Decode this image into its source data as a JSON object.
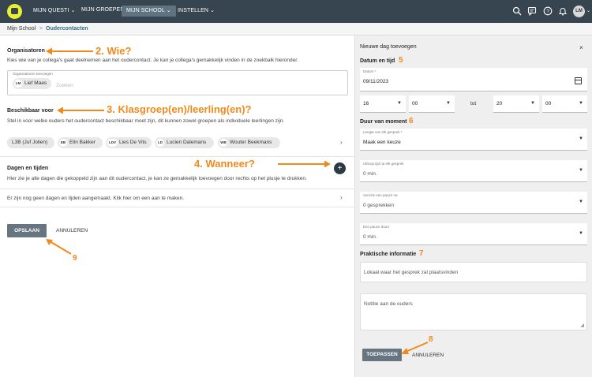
{
  "nav": {
    "items": [
      "MIJN QUESTI",
      "MIJN GROEPEN",
      "MIJN SCHOOL",
      "INSTELLEN"
    ],
    "avatar": "LM"
  },
  "breadcrumb": {
    "home": "Mijn School",
    "separator": ">",
    "current": "Oudercontacten"
  },
  "organisatoren": {
    "title": "Organisatoren",
    "desc": "Kies wie van je collega's gaat deelnemen aan het oudercontact. Je kan je collega's gemakkelijk vinden in de zoekbalk hieronder.",
    "field_label": "Organisatoren toevoegen",
    "chip_initials": "LM",
    "chip_name": "Lief Maes",
    "search_placeholder": "Zoeken"
  },
  "beschikbaar": {
    "title": "Beschikbaar voor",
    "desc": "Stel in voor welke ouders het oudercontact beschikbaar moet zijn, dit kunnen zowel groepen als individuele leerlingen zijn.",
    "chips": [
      {
        "initials": "",
        "name": "L3B (Juf Jolien)"
      },
      {
        "initials": "EB",
        "name": "Elin Bakker"
      },
      {
        "initials": "LDV",
        "name": "Lies De Vits"
      },
      {
        "initials": "LD",
        "name": "Lucien Dalemans"
      },
      {
        "initials": "WB",
        "name": "Wouter Beekmans"
      }
    ]
  },
  "dagen": {
    "title": "Dagen en tijden",
    "desc": "Hier zie je alle dagen die gekoppeld zijn aan dit oudercontact, je kan ze gemakkelijk toevoegen door rechts op het plusje te drukken.",
    "empty": "Er zijn nog geen dagen en tijden aangemaakt. Klik hier om een aan te maken.",
    "plus": "+"
  },
  "actions": {
    "save": "OPSLAAN",
    "cancel": "ANNULEREN"
  },
  "annotations": {
    "wie": "2. Wie?",
    "klas": "3. Klasgroep(en)/leerling(en)?",
    "wanneer": "4. Wanneer?",
    "n5": "5",
    "n6": "6",
    "n7": "7",
    "n8": "8",
    "n9": "9",
    "color": "#f08a1c"
  },
  "panel": {
    "title": "Nieuwe dag toevoegen",
    "close": "×",
    "datum_tijd": "Datum en tijd",
    "datum_label": "Datum *",
    "datum_value": "09/11/2023",
    "start_hour": "16",
    "start_min": "00",
    "tot": "tot",
    "end_hour": "20",
    "end_min": "00",
    "duur": "Duur van moment",
    "lengte_label": "Lengte van elk gesprek *",
    "lengte_value": "Maak een keuze",
    "uitloop_label": "Uitloop tijd na elk gesprek",
    "uitloop_value": "0 min.",
    "voorzie_label": "Voorzie een pauze na",
    "voorzie_value": "0 gesprekken",
    "pauze_label": "Een pauze duurt",
    "pauze_value": "0 min.",
    "praktisch": "Praktische informatie",
    "lokaal_placeholder": "Lokaal waar het gesprek zal plaatsvinden",
    "notitie_placeholder": "Notitie aan de ouders",
    "apply": "TOEPASSEN",
    "cancel": "ANNULEREN"
  }
}
